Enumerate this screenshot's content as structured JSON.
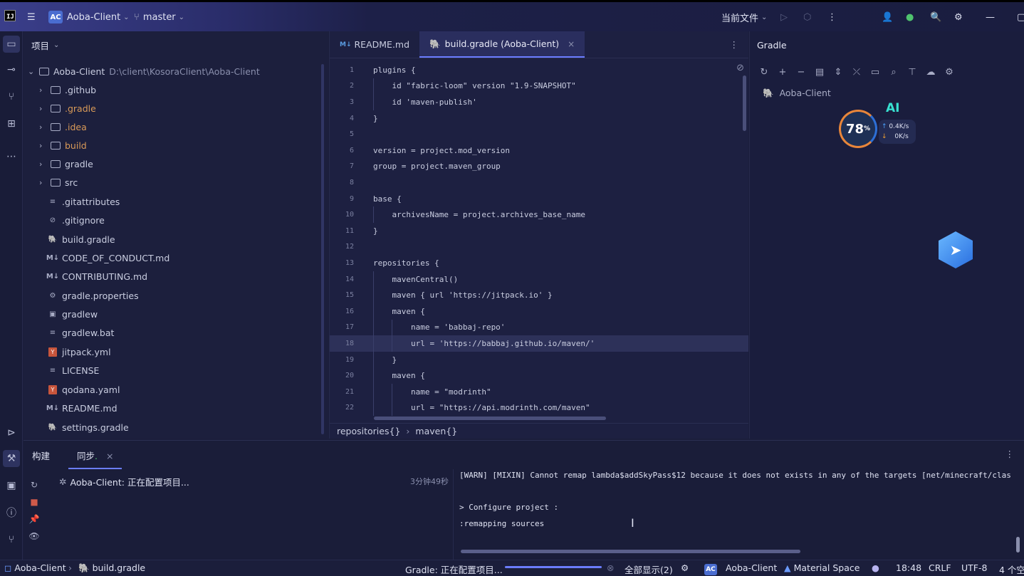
{
  "titlebar": {
    "project_badge": "AC",
    "project_name": "Aoba-Client",
    "branch": "master",
    "run_config": "当前文件"
  },
  "project_panel": {
    "header": "项目",
    "root": {
      "name": "Aoba-Client",
      "path": "D:\\client\\KosoraClient\\Aoba-Client"
    },
    "folders": [
      ".github",
      ".gradle",
      ".idea",
      "build",
      "gradle",
      "src"
    ],
    "files": [
      ".gitattributes",
      ".gitignore",
      "build.gradle",
      "CODE_OF_CONDUCT.md",
      "CONTRIBUTING.md",
      "gradle.properties",
      "gradlew",
      "gradlew.bat",
      "jitpack.yml",
      "LICENSE",
      "qodana.yaml",
      "README.md",
      "settings.gradle"
    ]
  },
  "editor": {
    "tabs": [
      {
        "label": "README.md"
      },
      {
        "label": "build.gradle (Aoba-Client)"
      }
    ],
    "active_line": 18,
    "lines": [
      "plugins {",
      "    id \"fabric-loom\" version \"1.9-SNAPSHOT\"",
      "    id 'maven-publish'",
      "}",
      "",
      "version = project.mod_version",
      "group = project.maven_group",
      "",
      "base {",
      "    archivesName = project.archives_base_name",
      "}",
      "",
      "repositories {",
      "    mavenCentral()",
      "    maven { url 'https://jitpack.io' }",
      "    maven {",
      "        name = 'babbaj-repo'",
      "        url = 'https://babbaj.github.io/maven/'",
      "    }",
      "    maven {",
      "        name = \"modrinth\"",
      "        url = \"https://api.modrinth.com/maven\""
    ],
    "breadcrumb": [
      "repositories{}",
      "maven{}"
    ]
  },
  "gradle_panel": {
    "title": "Gradle",
    "item": "Aoba-Client"
  },
  "widget": {
    "percent": "78",
    "ai_label": "AI",
    "upload": "0.4K/s",
    "download": "0K/s"
  },
  "build_panel": {
    "tabs": [
      "构建",
      "同步"
    ],
    "sync_item": "Aoba-Client: 正在配置项目...",
    "sync_time": "3分钟49秒",
    "console": [
      "[WARN] [MIXIN] Cannot remap lambda$addSkyPass$12 because it does not exists in any of the targets [net/minecraft/clas",
      "",
      "> Configure project :",
      ":remapping sources"
    ]
  },
  "statusbar": {
    "crumb_project": "Aoba-Client",
    "crumb_file": "build.gradle",
    "task": "Gradle: 正在配置项目...",
    "show_all": "全部显示(2)",
    "project_badge": "AC",
    "project": "Aoba-Client",
    "theme": "Material Space",
    "position": "18:48",
    "line_sep": "CRLF",
    "encoding": "UTF-8",
    "indent": "4 个空"
  }
}
